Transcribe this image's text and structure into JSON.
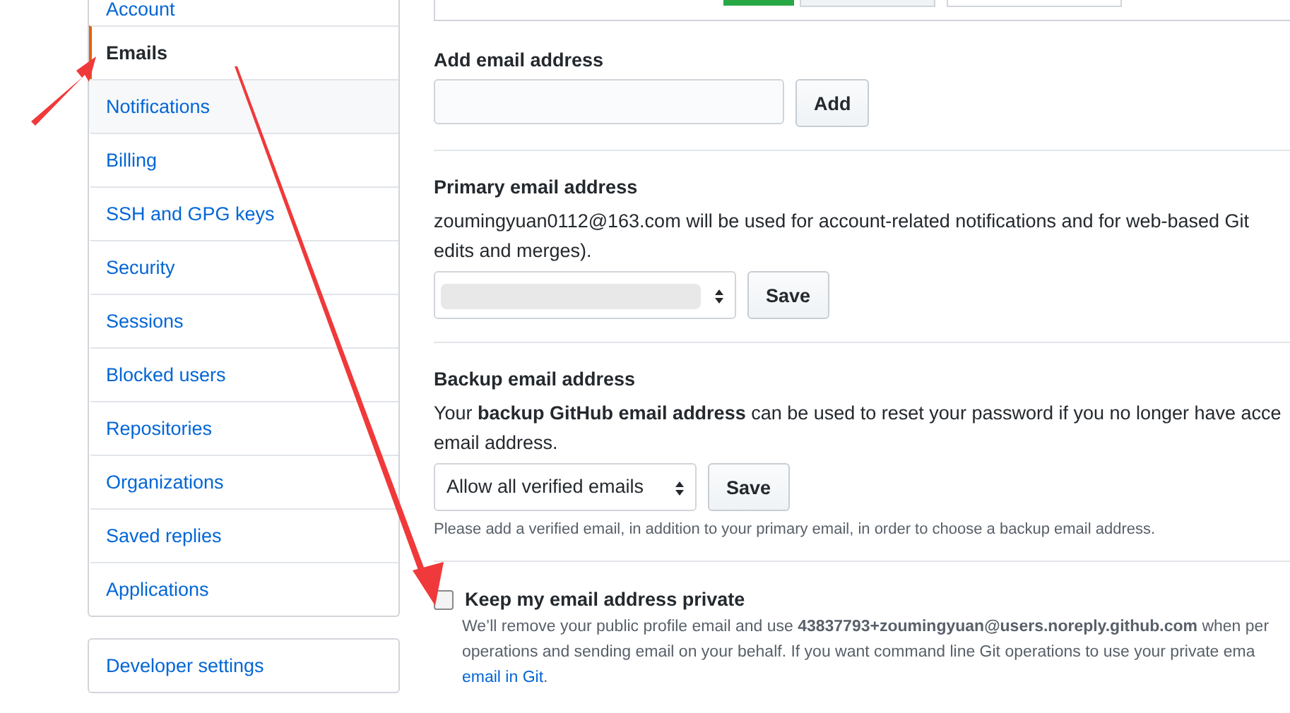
{
  "sidebar": {
    "items": [
      {
        "label": "Account",
        "selected": false
      },
      {
        "label": "Emails",
        "selected": true
      },
      {
        "label": "Notifications",
        "selected": false
      },
      {
        "label": "Billing",
        "selected": false
      },
      {
        "label": "SSH and GPG keys",
        "selected": false
      },
      {
        "label": "Security",
        "selected": false
      },
      {
        "label": "Sessions",
        "selected": false
      },
      {
        "label": "Blocked users",
        "selected": false
      },
      {
        "label": "Repositories",
        "selected": false
      },
      {
        "label": "Organizations",
        "selected": false
      },
      {
        "label": "Saved replies",
        "selected": false
      },
      {
        "label": "Applications",
        "selected": false
      }
    ],
    "developer_settings": "Developer settings"
  },
  "add_email": {
    "title": "Add email address",
    "button": "Add"
  },
  "primary_email": {
    "title": "Primary email address",
    "lines": [
      "zoumingyuan0112@163.com will be used for account-related notifications and for web-based Git",
      "edits and merges)."
    ],
    "button": "Save"
  },
  "backup_email": {
    "title": "Backup email address",
    "lines": [
      "Your **backup GitHub email address** can be used to reset your password if you no longer have acce",
      "email address."
    ],
    "select_value": "Allow all verified emails",
    "button": "Save",
    "note": "Please add a verified email, in addition to your primary email, in order to choose a backup email address."
  },
  "keep_private": {
    "label": "Keep my email address private",
    "checked": false,
    "lines": [
      "We’ll remove your public profile email and use **43837793+zoumingyuan@users.noreply.github.com** when per",
      "operations and sending email on your behalf. If you want command line Git operations to use your private ema"
    ],
    "link": "email in Git",
    "link_tail": "."
  }
}
